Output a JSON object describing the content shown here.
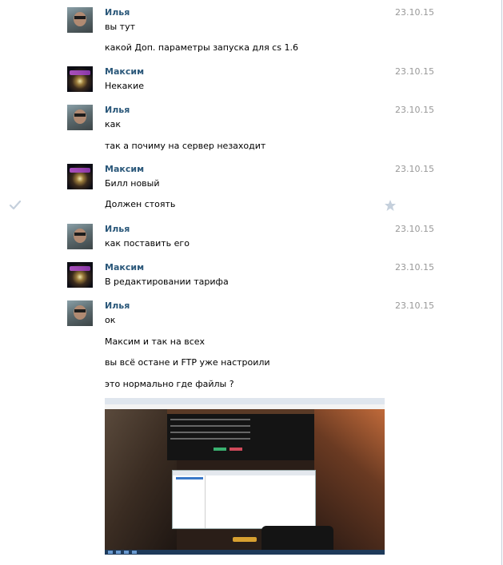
{
  "messages": [
    {
      "author": "Илья",
      "date": "23.10.15",
      "avatar": "ilya",
      "lines": [
        "вы тут",
        "какой Доп. параметры запуска для cs 1.6"
      ]
    },
    {
      "author": "Максим",
      "date": "23.10.15",
      "avatar": "maxim",
      "lines": [
        "Некакие"
      ]
    },
    {
      "author": "Илья",
      "date": "23.10.15",
      "avatar": "ilya",
      "lines": [
        "как",
        "так а почиму на сервер незаходит"
      ]
    },
    {
      "author": "Максим",
      "date": "23.10.15",
      "avatar": "maxim",
      "lines": [
        "Билл новый",
        "Должен стоять"
      ]
    },
    {
      "author": "Илья",
      "date": "23.10.15",
      "avatar": "ilya",
      "lines": [
        "как поставить его"
      ]
    },
    {
      "author": "Максим",
      "date": "23.10.15",
      "avatar": "maxim",
      "lines": [
        "В редактировании тарифа"
      ]
    },
    {
      "author": "Илья",
      "date": "23.10.15",
      "avatar": "ilya",
      "lines": [
        "ок",
        "Максим и так на всех",
        "вы всё остане и FTP уже настроили",
        "это нормально где файлы ?"
      ]
    }
  ],
  "icons": {
    "read_check": "check-icon",
    "favorite": "star-icon"
  },
  "attachment": {
    "type": "screenshot-image"
  },
  "colors": {
    "author": "#2b587a",
    "date": "#999999",
    "icon": "#c5d0dc",
    "border": "#c5cfda"
  }
}
